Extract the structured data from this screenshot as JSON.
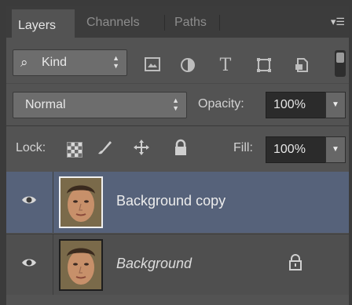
{
  "tabs": [
    {
      "label": "Layers",
      "active": true
    },
    {
      "label": "Channels",
      "active": false
    },
    {
      "label": "Paths",
      "active": false
    }
  ],
  "filter": {
    "kind_label": "Kind",
    "icons": [
      "image-filter-icon",
      "adjustment-filter-icon",
      "type-filter-icon",
      "shape-filter-icon",
      "smart-object-filter-icon"
    ]
  },
  "blend": {
    "mode": "Normal",
    "opacity_label": "Opacity:",
    "opacity_value": "100%"
  },
  "lock": {
    "label": "Lock:",
    "fill_label": "Fill:",
    "fill_value": "100%"
  },
  "layers": [
    {
      "name": "Background copy",
      "visible": true,
      "selected": true,
      "locked": false
    },
    {
      "name": "Background",
      "visible": true,
      "selected": false,
      "locked": true
    }
  ],
  "colors": {
    "panel": "#535353",
    "selected_layer": "#56627a",
    "tab_bar": "#3c3c3c"
  }
}
